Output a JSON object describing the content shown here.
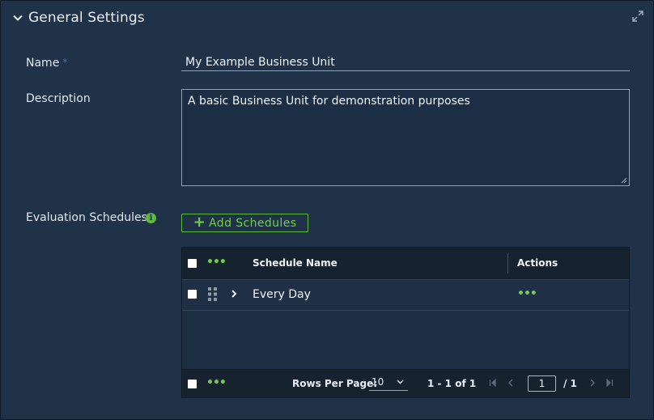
{
  "section": {
    "title": "General Settings"
  },
  "form": {
    "name_label": "Name",
    "required_marker": "*",
    "name_value": "My Example Business Unit",
    "description_label": "Description",
    "description_value": "A basic Business Unit for demonstration purposes",
    "schedules_label": "Evaluation Schedules",
    "info_icon_glyph": "i",
    "add_button_plus": "+",
    "add_button_label": "Add Schedules"
  },
  "grid": {
    "header_dots": "•••",
    "columns": [
      "Schedule Name",
      "Actions"
    ],
    "rows": [
      {
        "name": "Every Day",
        "actions": "•••"
      }
    ],
    "footer": {
      "dots": "•••",
      "rows_per_page_label": "Rows Per Page:",
      "rows_per_page_value": "10",
      "range_text": "1 - 1 of 1",
      "page_input": "1",
      "page_total": "/ 1"
    }
  },
  "colors": {
    "accent_green": "#6fcf49",
    "panel_bg": "#1f3248",
    "grid_header_bg": "#17222f"
  },
  "icons": {
    "collapse": "chevron-down-icon",
    "expand": "expand-icon",
    "info": "info-icon",
    "drag": "drag-handle-icon",
    "row_expand": "chevron-right-icon",
    "first": "first-page-icon",
    "prev": "previous-page-icon",
    "next": "next-page-icon",
    "last": "last-page-icon"
  }
}
